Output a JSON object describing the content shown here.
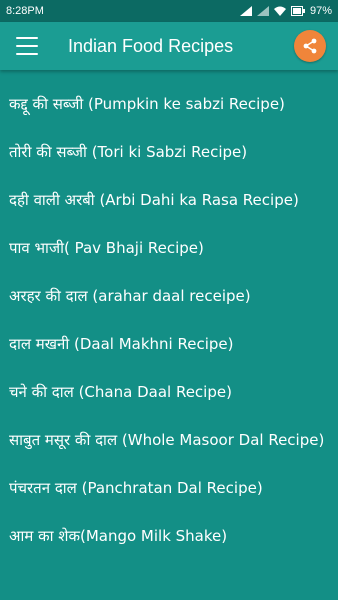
{
  "status_bar": {
    "time": "8:28PM",
    "battery": "97%"
  },
  "app_bar": {
    "title": "Indian Food Recipes",
    "menu_icon": "hamburger-menu-icon",
    "share_icon": "share-icon",
    "share_color": "#f0853a"
  },
  "colors": {
    "background": "#138f86",
    "app_bar": "#1b9d93",
    "status_bar": "#0c6a63"
  },
  "recipes": [
    {
      "label": "कद्दू की सब्जी (Pumpkin ke sabzi Recipe)"
    },
    {
      "label": "तोरी की सब्जी (Tori ki Sabzi Recipe)"
    },
    {
      "label": "दही वाली अरबी (Arbi Dahi ka Rasa Recipe)"
    },
    {
      "label": "पाव भाजी( Pav Bhaji Recipe)"
    },
    {
      "label": "अरहर की दाल (arahar daal receipe)"
    },
    {
      "label": "दाल मखनी (Daal Makhni Recipe)"
    },
    {
      "label": "चने की दाल (Chana Daal Recipe)"
    },
    {
      "label": "साबुत मसूर की दाल (Whole Masoor Dal Recipe)"
    },
    {
      "label": "पंचरतन दाल (Panchratan Dal Recipe)"
    },
    {
      "label": "आम का शेक(Mango Milk Shake)"
    }
  ]
}
